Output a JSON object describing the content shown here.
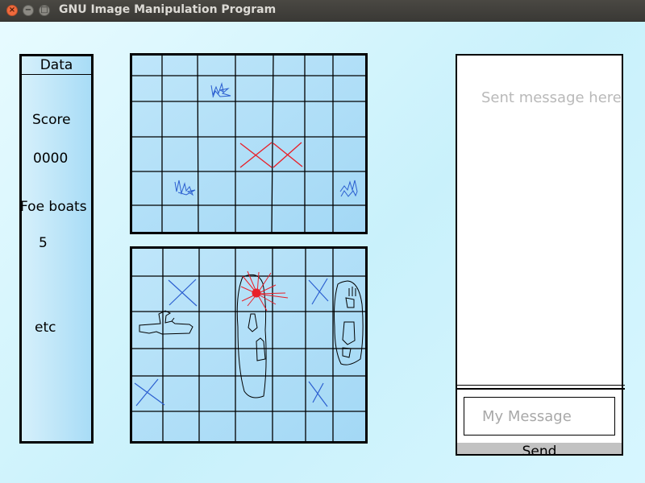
{
  "window": {
    "title": "GNU Image Manipulation Program",
    "buttons": {
      "close": "×",
      "minimize": "−",
      "maximize": "□"
    }
  },
  "data_panel": {
    "header": "Data",
    "score_label": "Score",
    "score_value": "0000",
    "foe_boats_label": "Foe boats",
    "foe_boats_value": "5",
    "etc_label": "etc"
  },
  "enemy_board": {
    "rows": 6,
    "cols": 7
  },
  "player_board": {
    "rows": 6,
    "cols": 7
  },
  "chat": {
    "sent_placeholder": "Sent message here",
    "message_placeholder": "My Message",
    "send_label": "Send"
  },
  "colors": {
    "board_fill": "#a9dcf6",
    "hit_red": "#e8202a",
    "miss_blue": "#2b5fd0",
    "ink": "#000000"
  }
}
